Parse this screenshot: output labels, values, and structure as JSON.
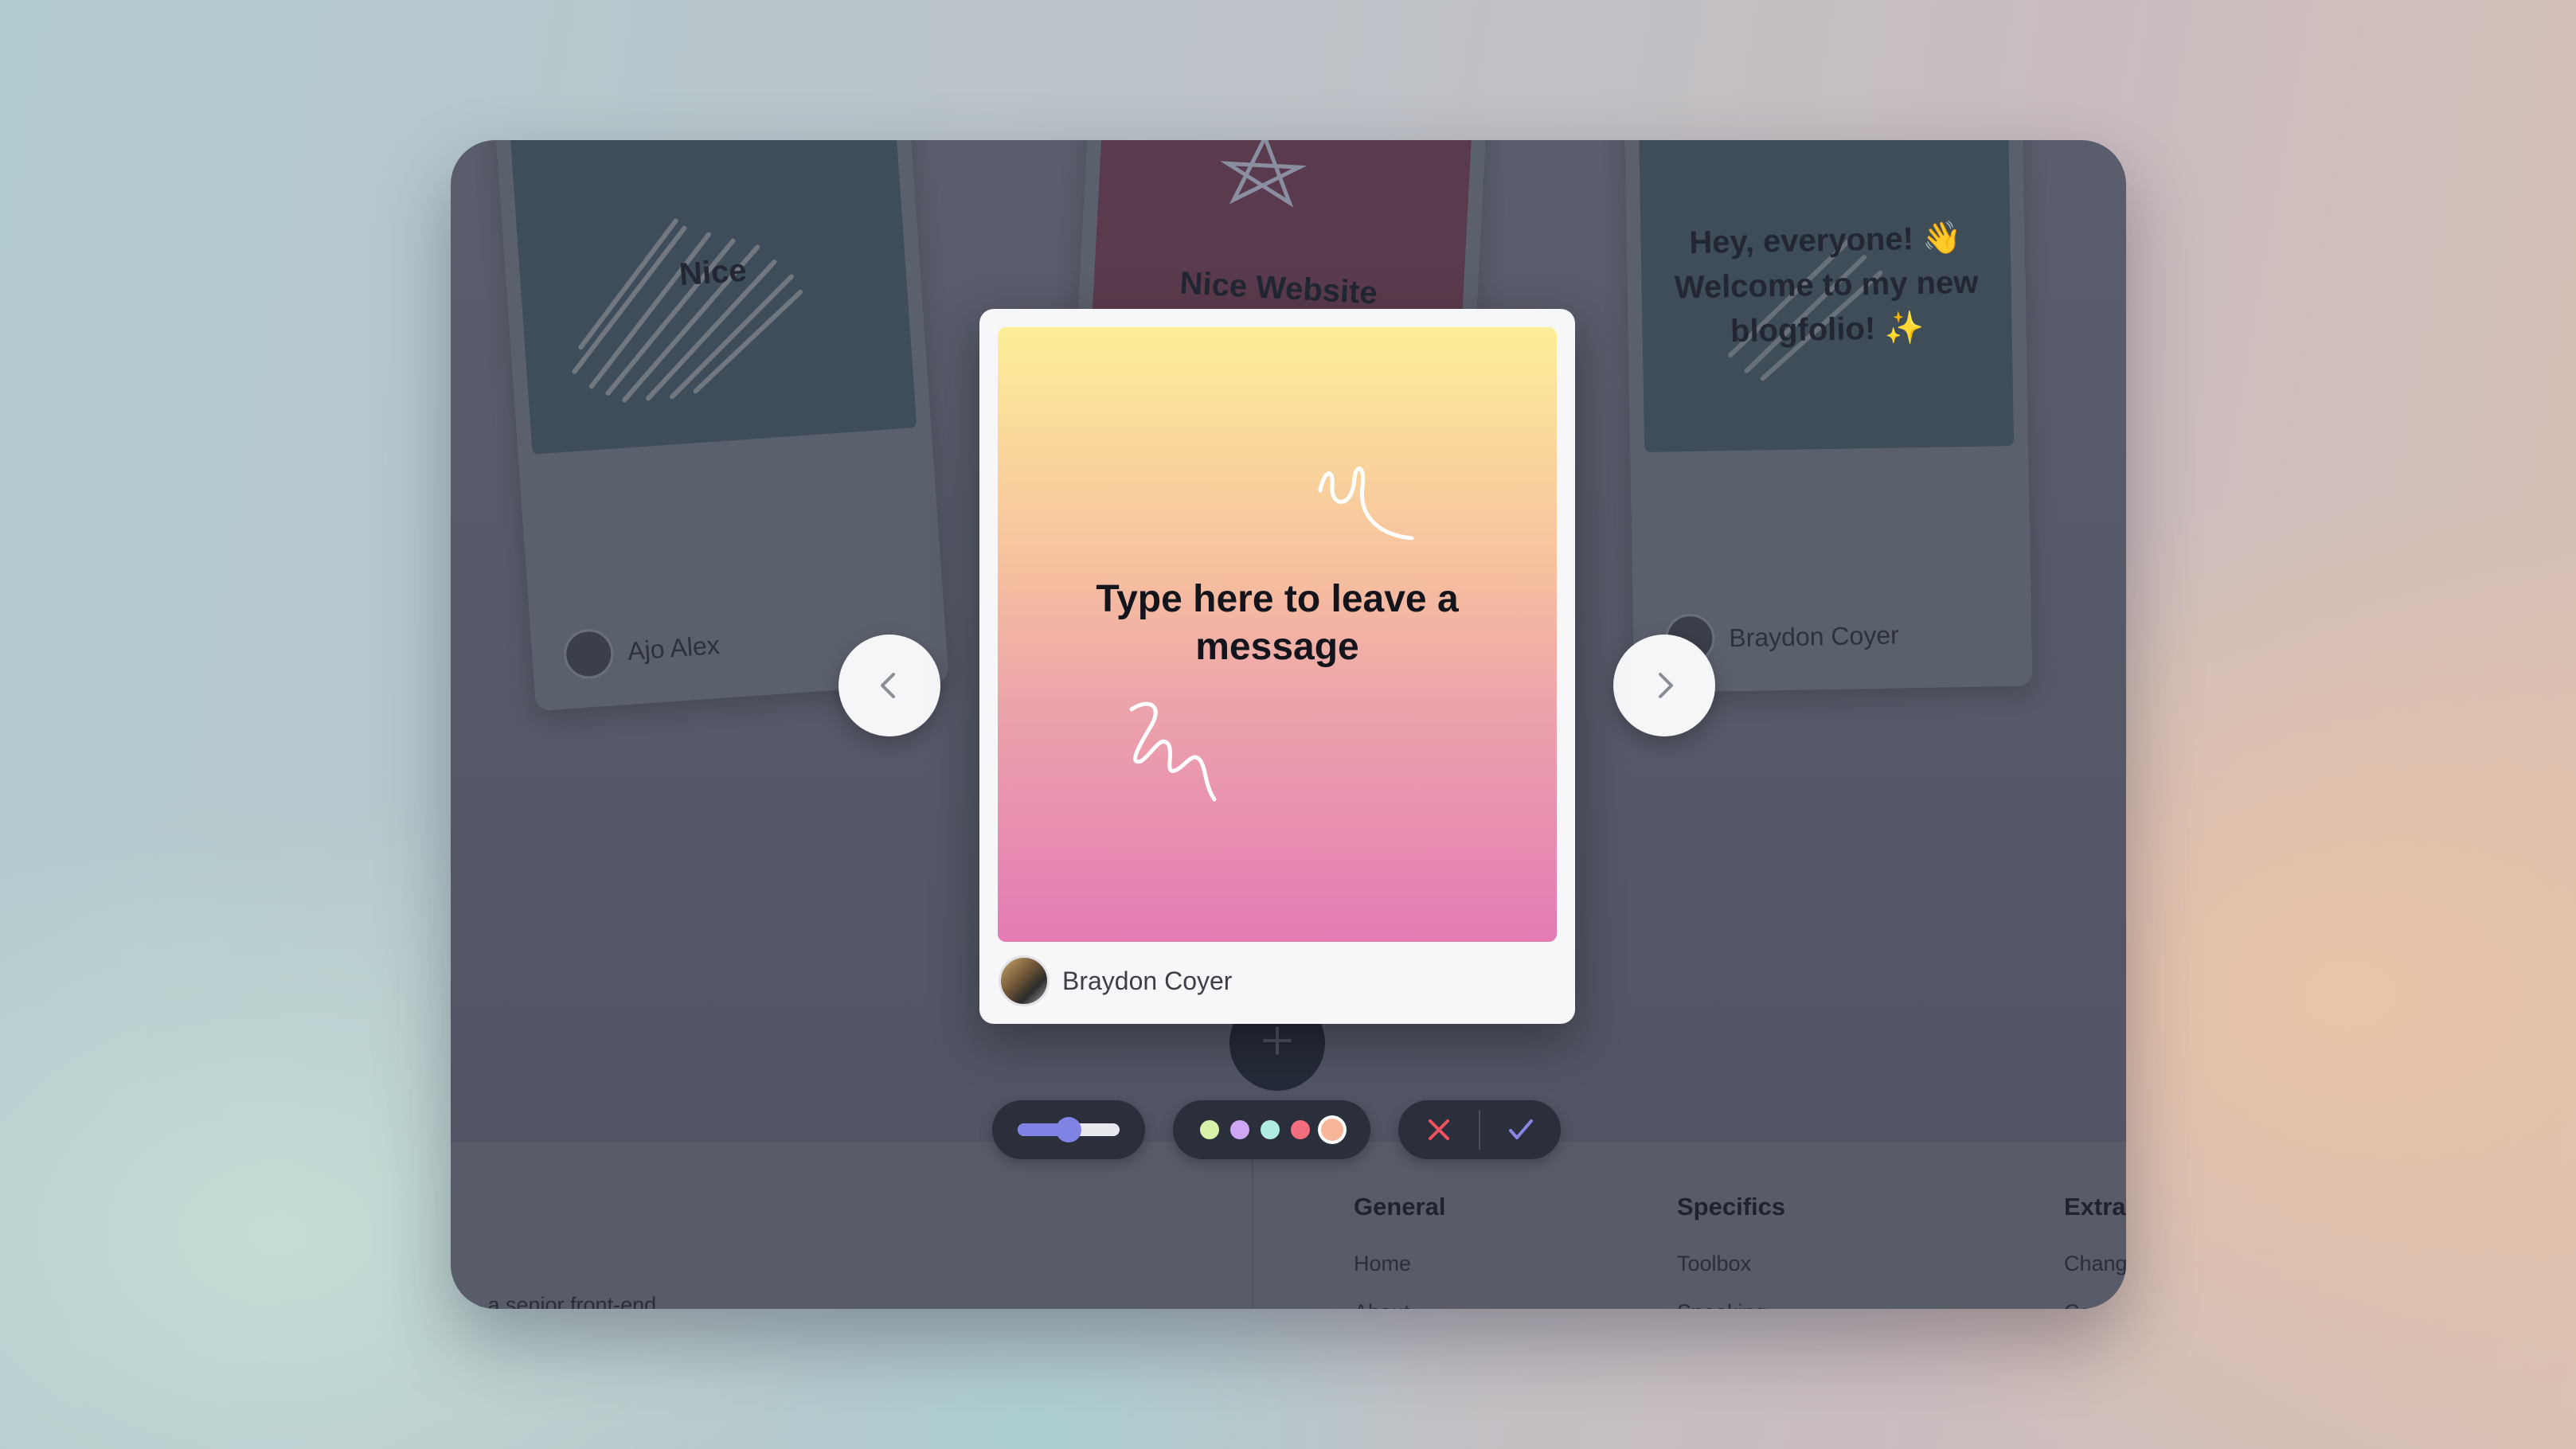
{
  "background_cards": [
    {
      "text": "Nice",
      "author": "Ajo Alex"
    },
    {
      "text": "Nice Website",
      "author": ""
    },
    {
      "text": "Hey, everyone! 👋 Welcome to my new blogfolio! ✨",
      "author": "Braydon Coyer"
    }
  ],
  "card": {
    "prompt": "Type here to leave a message",
    "author": "Braydon Coyer",
    "gradient_top": "#fdee98",
    "gradient_bottom": "#e57bb5"
  },
  "navigation": {
    "prev_icon": "chevron-left-icon",
    "next_icon": "chevron-right-icon"
  },
  "toolbar": {
    "add_icon": "plus-icon",
    "brush_size": 0.5,
    "colors": [
      "#d9f2a9",
      "#cfa6f3",
      "#b0ece0",
      "#f26d7d",
      "#f7b59a"
    ],
    "selected_color_index": 4,
    "cancel_icon": "close-icon",
    "confirm_icon": "check-icon",
    "cancel_color": "#f0525f",
    "confirm_color": "#8a86e6"
  },
  "footer": {
    "bio_fragment": "- a senior front-end",
    "columns": [
      {
        "heading": "General",
        "links": [
          "Home",
          "About"
        ]
      },
      {
        "heading": "Specifics",
        "links": [
          "Toolbox",
          "Speaking"
        ]
      },
      {
        "heading": "Extra",
        "links": [
          "Chang",
          "Co"
        ]
      }
    ]
  }
}
